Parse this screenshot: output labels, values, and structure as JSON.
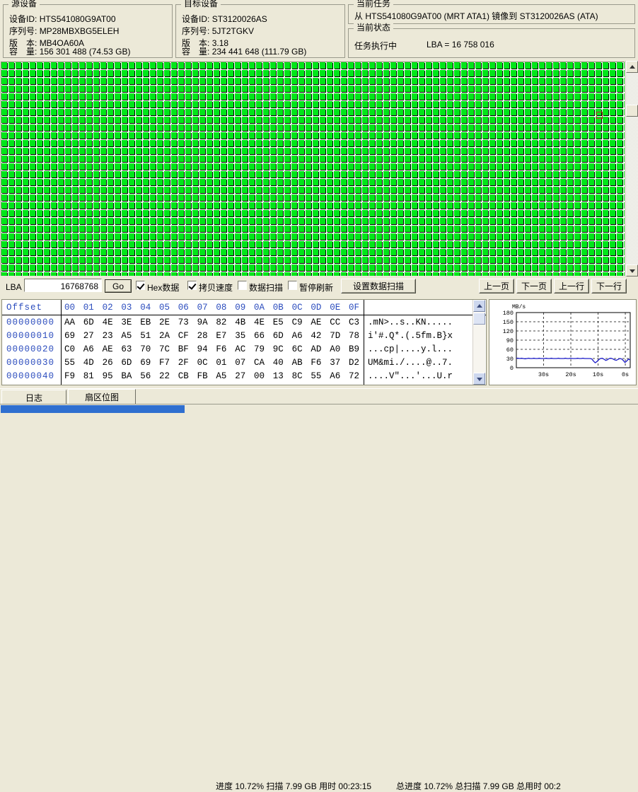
{
  "source_device": {
    "legend": "源设备",
    "rows": [
      {
        "label": "设备ID:",
        "value": "HTS541080G9AT00"
      },
      {
        "label": "序列号:",
        "value": "MP28MBXBG5ELEH"
      },
      {
        "label": "版　本:",
        "value": "MB4OA60A"
      },
      {
        "label": "容　量:",
        "value": "156 301 488 (74.53 GB)"
      }
    ]
  },
  "target_device": {
    "legend": "目标设备",
    "rows": [
      {
        "label": "设备ID:",
        "value": "ST3120026AS"
      },
      {
        "label": "序列号:",
        "value": "5JT2TGKV"
      },
      {
        "label": "版　本:",
        "value": "3.18"
      },
      {
        "label": "容　量:",
        "value": "234 441 648 (111.79 GB)"
      }
    ]
  },
  "current_task": {
    "legend": "当前任务",
    "text": "从 HTS541080G9AT00 (MRT ATA1) 镜像到 ST3120026AS (ATA)"
  },
  "current_status": {
    "legend": "当前状态",
    "state": "任务执行中",
    "lba_label": "LBA = 16 758 016"
  },
  "map": {
    "cell_color": "#00e619",
    "cursor_color": "#c83232",
    "cols": 89,
    "rows": 28
  },
  "toolbar": {
    "lba_label": "LBA",
    "lba_value": "16768768",
    "go_label": "Go",
    "checkboxes": [
      {
        "label": "Hex数据",
        "checked": true
      },
      {
        "label": "拷贝速度",
        "checked": true
      },
      {
        "label": "数据扫描",
        "checked": false
      },
      {
        "label": "暂停刷新",
        "checked": false
      }
    ],
    "scan_settings_label": "设置数据扫描",
    "nav": [
      "上一页",
      "下一页",
      "上一行",
      "下一行"
    ]
  },
  "hex_view": {
    "offset_header": "Offset",
    "byte_headers": [
      "00",
      "01",
      "02",
      "03",
      "04",
      "05",
      "06",
      "07",
      "08",
      "09",
      "0A",
      "0B",
      "0C",
      "0D",
      "0E",
      "0F"
    ],
    "rows": [
      {
        "offset": "00000000",
        "bytes": [
          "AA",
          "6D",
          "4E",
          "3E",
          "EB",
          "2E",
          "73",
          "9A",
          "82",
          "4B",
          "4E",
          "E5",
          "C9",
          "AE",
          "CC",
          "C3"
        ],
        "ascii": ".mN>..s..KN....."
      },
      {
        "offset": "00000010",
        "bytes": [
          "69",
          "27",
          "23",
          "A5",
          "51",
          "2A",
          "CF",
          "28",
          "E7",
          "35",
          "66",
          "6D",
          "A6",
          "42",
          "7D",
          "78"
        ],
        "ascii": "i'#.Q*.(.5fm.B}x"
      },
      {
        "offset": "00000020",
        "bytes": [
          "C0",
          "A6",
          "AE",
          "63",
          "70",
          "7C",
          "BF",
          "94",
          "F6",
          "AC",
          "79",
          "9C",
          "6C",
          "AD",
          "A0",
          "B9"
        ],
        "ascii": "...cp|....y.l..."
      },
      {
        "offset": "00000030",
        "bytes": [
          "55",
          "4D",
          "26",
          "6D",
          "69",
          "F7",
          "2F",
          "0C",
          "01",
          "07",
          "CA",
          "40",
          "AB",
          "F6",
          "37",
          "D2"
        ],
        "ascii": "UM&mi./....@..7."
      },
      {
        "offset": "00000040",
        "bytes": [
          "F9",
          "81",
          "95",
          "BA",
          "56",
          "22",
          "CB",
          "FB",
          "A5",
          "27",
          "00",
          "13",
          "8C",
          "55",
          "A6",
          "72"
        ],
        "ascii": "....V\"...'...U.r"
      }
    ]
  },
  "chart_data": {
    "type": "line",
    "title": "MB/s",
    "ylabel": "MB/s",
    "xlabel": "",
    "ylim": [
      0,
      180
    ],
    "yticks": [
      0,
      30,
      60,
      90,
      120,
      150,
      180
    ],
    "xticks": [
      "30s",
      "20s",
      "10s",
      "0s"
    ],
    "grid": true,
    "legend": "none",
    "line_color": "#1c1cc8",
    "series": [
      {
        "name": "copy speed",
        "values": [
          31,
          31,
          30,
          31,
          30,
          29,
          30,
          31,
          30,
          30,
          31,
          30,
          30,
          31,
          30,
          30,
          30,
          31,
          30,
          30,
          31,
          30,
          30,
          30,
          31,
          30,
          30,
          30,
          31,
          30,
          30,
          31,
          30,
          30,
          30,
          31,
          30,
          30,
          31,
          30,
          30,
          30,
          30,
          29,
          22,
          16,
          20,
          26,
          30,
          31,
          28,
          24,
          26,
          30,
          31,
          29,
          26,
          24,
          27,
          30,
          29,
          24,
          17,
          22,
          28,
          26
        ]
      }
    ]
  },
  "tabs": [
    {
      "label": "日志",
      "active": false
    },
    {
      "label": "扇区位图",
      "active": true
    }
  ],
  "status_bar": {
    "left": "进度 10.72% 扫描 7.99 GB 用时 00:23:15",
    "right": "总进度 10.72% 总扫描 7.99 GB 总用时 00:2",
    "progress_percent": 10.72,
    "progress_color": "#2f6fd0"
  }
}
